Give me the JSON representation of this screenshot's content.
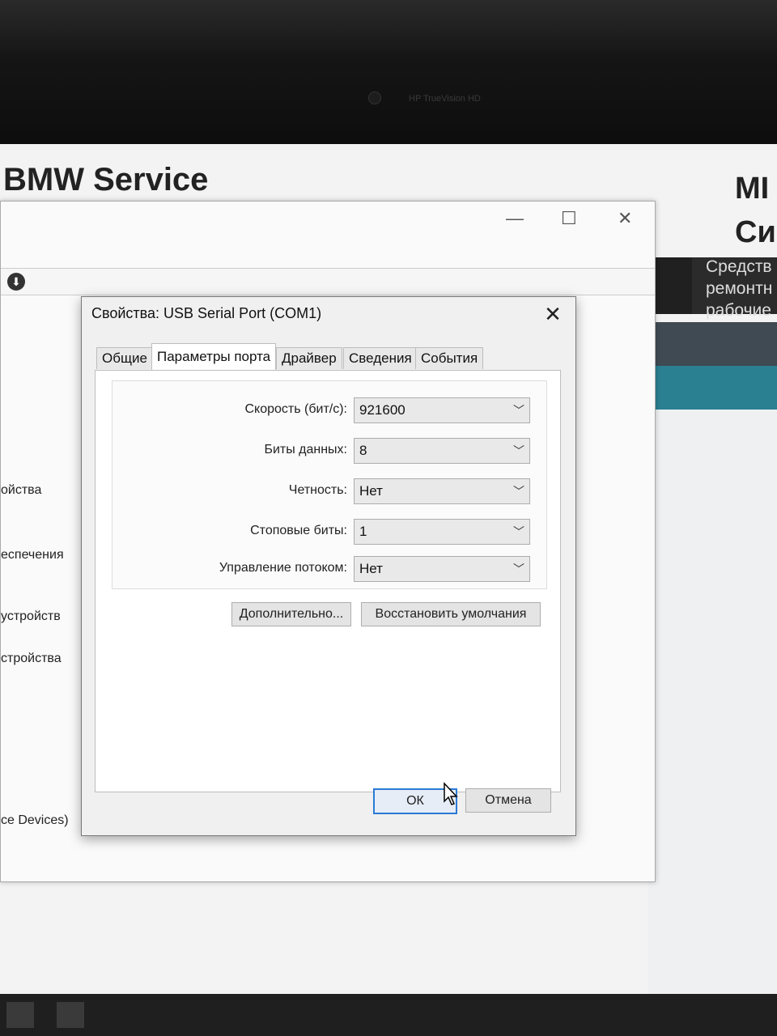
{
  "monitor": {
    "camera_label": "HP TrueVision HD"
  },
  "background_app": {
    "title": "BMW Service",
    "right_title_line1": "MI",
    "right_title_line2": "Си",
    "right_desc_lines": [
      "Средств",
      "ремонтн",
      "рабочие"
    ]
  },
  "device_manager": {
    "controls": {
      "minimize": "—",
      "maximize": "☐",
      "close": "✕"
    },
    "tree_items": [
      "ойства",
      "еспечения",
      "устройств",
      "стройства",
      "ce Devices)"
    ]
  },
  "dialog": {
    "title": "Свойства: USB Serial Port (COM1)",
    "close_glyph": "✕",
    "tabs": [
      "Общие",
      "Параметры порта",
      "Драйвер",
      "Сведения",
      "События"
    ],
    "active_tab": "Параметры порта",
    "fields": [
      {
        "label": "Скорость (бит/с):",
        "value": "921600"
      },
      {
        "label": "Биты данных:",
        "value": "8"
      },
      {
        "label": "Четность:",
        "value": "Нет"
      },
      {
        "label": "Стоповые биты:",
        "value": "1"
      },
      {
        "label": "Управление потоком:",
        "value": "Нет"
      }
    ],
    "advanced_button": "Дополнительно...",
    "restore_button": "Восстановить умолчания",
    "ok_button": "ОК",
    "cancel_button": "Отмена"
  },
  "colors": {
    "accent_focus": "#2a7ad5",
    "teal_band": "#2a7f91"
  }
}
